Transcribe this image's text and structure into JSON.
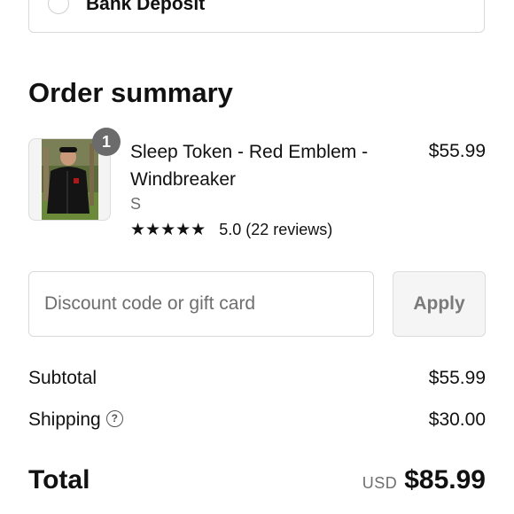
{
  "payment": {
    "option_label": "Bank Deposit"
  },
  "order_summary": {
    "title": "Order summary",
    "product": {
      "quantity": "1",
      "title": "Sleep Token - Red Emblem - Windbreaker",
      "variant": "S",
      "stars": "★★★★★",
      "rating_text": "5.0 (22 reviews)",
      "price": "$55.99",
      "image": "person-wearing-black-windbreaker"
    },
    "discount": {
      "placeholder": "Discount code or gift card",
      "value": "",
      "apply_label": "Apply"
    },
    "subtotal": {
      "label": "Subtotal",
      "value": "$55.99"
    },
    "shipping": {
      "label": "Shipping",
      "value": "$30.00",
      "help_icon": "question-circle-icon"
    },
    "total": {
      "label": "Total",
      "currency": "USD",
      "value": "$85.99"
    }
  }
}
